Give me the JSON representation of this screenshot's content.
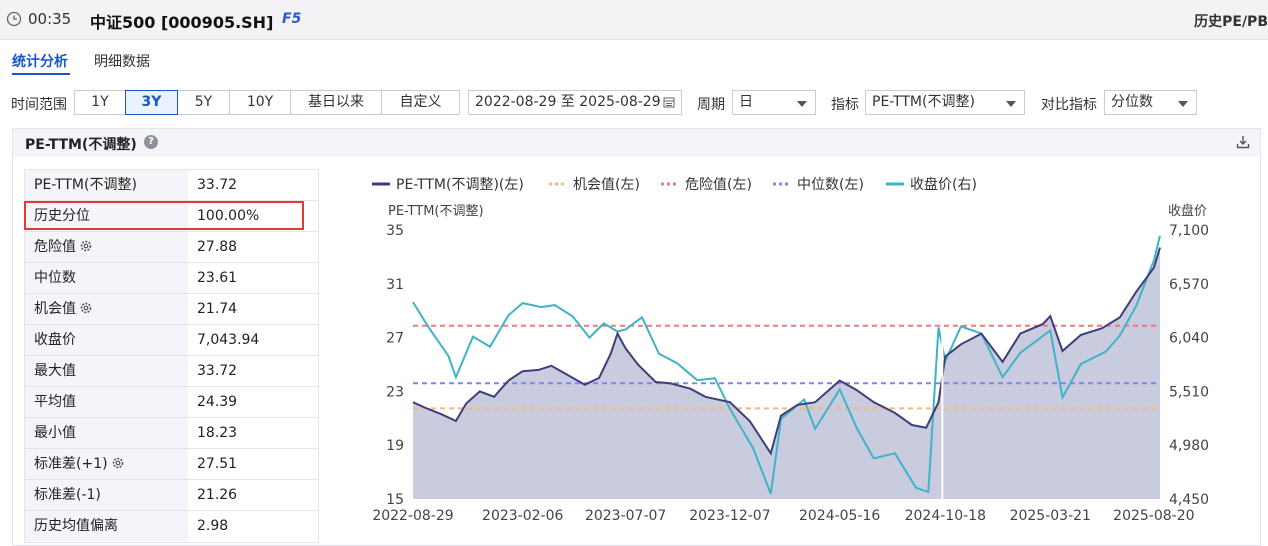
{
  "header": {
    "time": "00:35",
    "title": "中证500 [000905.SH]",
    "f5": "F5",
    "right_title": "历史PE/PB"
  },
  "tabs": [
    {
      "label": "统计分析",
      "active": true
    },
    {
      "label": "明细数据",
      "active": false
    }
  ],
  "filters": {
    "range_label": "时间范围",
    "ranges": [
      "1Y",
      "3Y",
      "5Y",
      "10Y",
      "基日以来",
      "自定义"
    ],
    "active_range": "3Y",
    "date_range": "2022-08-29 至 2025-08-29",
    "period_label": "周期",
    "period_value": "日",
    "indicator_label": "指标",
    "indicator_value": "PE-TTM(不调整)",
    "compare_label": "对比指标",
    "compare_value": "分位数"
  },
  "panel": {
    "title": "PE-TTM(不调整)"
  },
  "stats": [
    {
      "label": "PE-TTM(不调整)",
      "value": "33.72",
      "gear": false
    },
    {
      "label": "历史分位",
      "value": "100.00%",
      "gear": false,
      "highlight": true
    },
    {
      "label": "危险值",
      "value": "27.88",
      "gear": true
    },
    {
      "label": "中位数",
      "value": "23.61",
      "gear": false
    },
    {
      "label": "机会值",
      "value": "21.74",
      "gear": true
    },
    {
      "label": "收盘价",
      "value": "7,043.94",
      "gear": false
    },
    {
      "label": "最大值",
      "value": "33.72",
      "gear": false
    },
    {
      "label": "平均值",
      "value": "24.39",
      "gear": false
    },
    {
      "label": "最小值",
      "value": "18.23",
      "gear": false
    },
    {
      "label": "标准差(+1)",
      "value": "27.51",
      "gear": true
    },
    {
      "label": "标准差(-1)",
      "value": "21.26",
      "gear": false
    },
    {
      "label": "历史均值偏离",
      "value": "2.98",
      "gear": false
    }
  ],
  "colors": {
    "pe_line": "#3d3f7a",
    "pe_fill": "#bfc2d8",
    "opportunity": "#f5b87a",
    "danger": "#f07a7a",
    "median": "#7d86f0",
    "close": "#3fb3c8",
    "accent": "#1a55c9"
  },
  "chart_data": {
    "type": "line",
    "legend_position": "top",
    "grid": false,
    "left_axis_title": "PE-TTM(不调整)",
    "right_axis_title": "收盘价",
    "left_ylim": [
      15,
      35
    ],
    "left_ticks": [
      "35",
      "31",
      "27",
      "23",
      "19",
      "15"
    ],
    "right_ylim": [
      4450,
      7100
    ],
    "right_ticks": [
      "7,100",
      "6,570",
      "6,040",
      "5,510",
      "4,980",
      "4,450"
    ],
    "xlim": [
      "2022-08-29",
      "2025-08-29"
    ],
    "x_ticks": [
      "2022-08-29",
      "2023-02-06",
      "2023-07-07",
      "2023-12-07",
      "2024-05-16",
      "2024-10-18",
      "2025-03-21",
      "2025-08-20"
    ],
    "series": [
      {
        "name": "PE-TTM(不调整)(左)",
        "axis": "left",
        "style": "solid-area",
        "points": [
          [
            "2022-08-29",
            22.2
          ],
          [
            "2022-09-15",
            21.8
          ],
          [
            "2022-10-10",
            21.3
          ],
          [
            "2022-10-31",
            20.8
          ],
          [
            "2022-11-15",
            22.1
          ],
          [
            "2022-12-05",
            23.0
          ],
          [
            "2022-12-26",
            22.6
          ],
          [
            "2023-01-16",
            23.8
          ],
          [
            "2023-02-06",
            24.5
          ],
          [
            "2023-03-01",
            24.6
          ],
          [
            "2023-03-20",
            24.9
          ],
          [
            "2023-04-10",
            24.3
          ],
          [
            "2023-05-08",
            23.5
          ],
          [
            "2023-05-29",
            24.0
          ],
          [
            "2023-06-15",
            25.8
          ],
          [
            "2023-06-25",
            27.3
          ],
          [
            "2023-07-07",
            26.2
          ],
          [
            "2023-07-25",
            25.0
          ],
          [
            "2023-08-20",
            23.7
          ],
          [
            "2023-09-10",
            23.6
          ],
          [
            "2023-10-10",
            23.2
          ],
          [
            "2023-11-01",
            22.6
          ],
          [
            "2023-12-07",
            22.2
          ],
          [
            "2024-01-05",
            20.8
          ],
          [
            "2024-02-05",
            18.4
          ],
          [
            "2024-02-20",
            21.2
          ],
          [
            "2024-03-15",
            22.0
          ],
          [
            "2024-04-10",
            22.2
          ],
          [
            "2024-05-16",
            23.8
          ],
          [
            "2024-06-10",
            23.1
          ],
          [
            "2024-07-05",
            22.2
          ],
          [
            "2024-08-05",
            21.4
          ],
          [
            "2024-08-30",
            20.5
          ],
          [
            "2024-09-20",
            20.3
          ],
          [
            "2024-10-08",
            22.2
          ],
          [
            "2024-10-18",
            25.6
          ],
          [
            "2024-11-10",
            26.5
          ],
          [
            "2024-12-10",
            27.3
          ],
          [
            "2025-01-10",
            25.2
          ],
          [
            "2025-02-05",
            27.3
          ],
          [
            "2025-03-10",
            28.0
          ],
          [
            "2025-03-21",
            28.6
          ],
          [
            "2025-04-08",
            26.0
          ],
          [
            "2025-05-05",
            27.2
          ],
          [
            "2025-06-05",
            27.7
          ],
          [
            "2025-07-01",
            28.5
          ],
          [
            "2025-07-25",
            30.4
          ],
          [
            "2025-08-20",
            32.2
          ],
          [
            "2025-08-29",
            33.7
          ]
        ]
      },
      {
        "name": "机会值(左)",
        "axis": "left",
        "style": "dashed",
        "value": 21.74
      },
      {
        "name": "危险值(左)",
        "axis": "left",
        "style": "dashed",
        "value": 27.88
      },
      {
        "name": "中位数(左)",
        "axis": "left",
        "style": "dashed",
        "value": 23.61
      },
      {
        "name": "收盘价(右)",
        "axis": "right",
        "style": "solid",
        "points": [
          [
            "2022-08-29",
            6390
          ],
          [
            "2022-09-20",
            6150
          ],
          [
            "2022-10-20",
            5860
          ],
          [
            "2022-10-31",
            5650
          ],
          [
            "2022-11-25",
            6050
          ],
          [
            "2022-12-20",
            5950
          ],
          [
            "2023-01-16",
            6260
          ],
          [
            "2023-02-06",
            6380
          ],
          [
            "2023-03-05",
            6340
          ],
          [
            "2023-03-25",
            6360
          ],
          [
            "2023-04-20",
            6250
          ],
          [
            "2023-05-15",
            6040
          ],
          [
            "2023-06-05",
            6180
          ],
          [
            "2023-06-25",
            6100
          ],
          [
            "2023-07-07",
            6120
          ],
          [
            "2023-07-31",
            6240
          ],
          [
            "2023-08-25",
            5880
          ],
          [
            "2023-09-20",
            5790
          ],
          [
            "2023-10-20",
            5620
          ],
          [
            "2023-11-15",
            5640
          ],
          [
            "2023-12-07",
            5340
          ],
          [
            "2024-01-10",
            4950
          ],
          [
            "2024-02-05",
            4500
          ],
          [
            "2024-02-20",
            5240
          ],
          [
            "2024-03-25",
            5430
          ],
          [
            "2024-04-10",
            5140
          ],
          [
            "2024-05-16",
            5530
          ],
          [
            "2024-06-10",
            5150
          ],
          [
            "2024-07-05",
            4850
          ],
          [
            "2024-08-05",
            4900
          ],
          [
            "2024-09-05",
            4560
          ],
          [
            "2024-09-23",
            4520
          ],
          [
            "2024-10-08",
            6140
          ],
          [
            "2024-10-18",
            5810
          ],
          [
            "2024-11-10",
            6150
          ],
          [
            "2024-12-10",
            6080
          ],
          [
            "2025-01-10",
            5650
          ],
          [
            "2025-02-05",
            5890
          ],
          [
            "2025-03-21",
            6110
          ],
          [
            "2025-04-08",
            5450
          ],
          [
            "2025-05-05",
            5780
          ],
          [
            "2025-06-10",
            5900
          ],
          [
            "2025-07-01",
            6060
          ],
          [
            "2025-07-25",
            6350
          ],
          [
            "2025-08-20",
            6800
          ],
          [
            "2025-08-29",
            7044
          ]
        ]
      }
    ]
  }
}
